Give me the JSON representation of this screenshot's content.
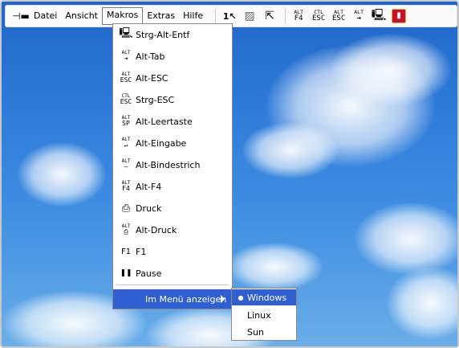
{
  "toolbar": {
    "pin_icon": "pin-icon",
    "menus": [
      "Datei",
      "Ansicht",
      "Makros",
      "Extras",
      "Hilfe"
    ],
    "open_menu": "Makros",
    "buttons": [
      {
        "name": "mouse-1-icon",
        "glyph": "1↖"
      },
      {
        "name": "screen-icon",
        "glyph": "▨"
      },
      {
        "name": "pointer-icon",
        "glyph": "⇱"
      },
      {
        "name": "alt-f4-icon",
        "top": "ALT",
        "bottom": "F4"
      },
      {
        "name": "ctrl-esc-icon",
        "top": "CTL",
        "bottom": "ESC"
      },
      {
        "name": "alt-esc-icon",
        "top": "ALT",
        "bottom": "ESC"
      },
      {
        "name": "alt-tab-icon",
        "top": "ALT",
        "bottom": "⇥"
      },
      {
        "name": "computer-icon",
        "glyph": "🖳"
      },
      {
        "name": "exit-icon",
        "glyph": "▮"
      }
    ]
  },
  "makros_menu": {
    "items": [
      {
        "label": "Strg-Alt-Entf",
        "icon": "computer-icon",
        "glyph": "🖳"
      },
      {
        "label": "Alt-Tab",
        "icon": "alt-tab-icon",
        "top": "ALT",
        "bottom": "⇥"
      },
      {
        "label": "Alt-ESC",
        "icon": "alt-esc-icon",
        "top": "ALT",
        "bottom": "ESC"
      },
      {
        "label": "Strg-ESC",
        "icon": "ctrl-esc-icon",
        "top": "CTL",
        "bottom": "ESC"
      },
      {
        "label": "Alt-Leertaste",
        "icon": "alt-space-icon",
        "top": "ALT",
        "bottom": "SP"
      },
      {
        "label": "Alt-Eingabe",
        "icon": "alt-enter-icon",
        "top": "ALT",
        "bottom": "↵"
      },
      {
        "label": "Alt-Bindestrich",
        "icon": "alt-hyphen-icon",
        "top": "ALT",
        "bottom": "—"
      },
      {
        "label": "Alt-F4",
        "icon": "alt-f4-icon",
        "top": "ALT",
        "bottom": "F4"
      },
      {
        "label": "Druck",
        "icon": "print-icon",
        "glyph": "⎙"
      },
      {
        "label": "Alt-Druck",
        "icon": "alt-print-icon",
        "top": "ALT",
        "bottom": "⎙"
      },
      {
        "label": "F1",
        "icon": "f1-icon",
        "glyph": "F1"
      },
      {
        "label": "Pause",
        "icon": "pause-icon",
        "glyph": "❚❚"
      }
    ],
    "show_in_menu_label": "Im Menü anzeigen"
  },
  "submenu": {
    "options": [
      "Windows",
      "Linux",
      "Sun"
    ],
    "selected": "Windows"
  }
}
